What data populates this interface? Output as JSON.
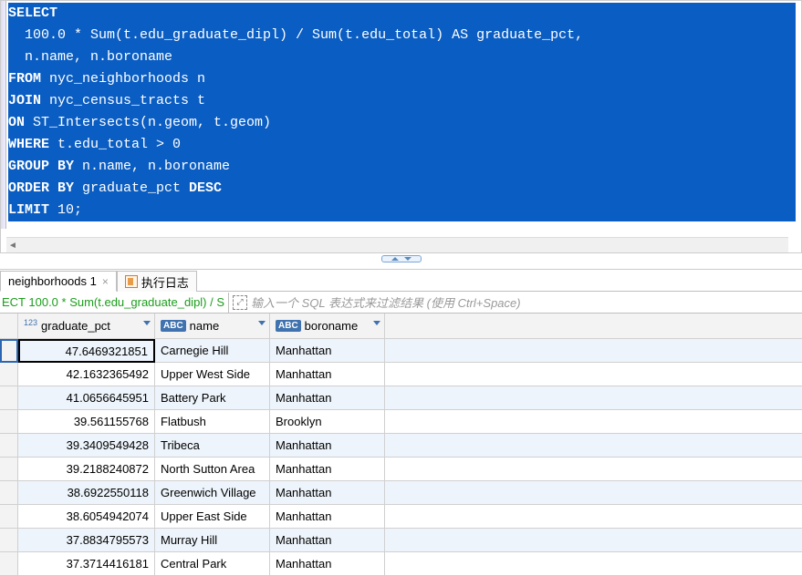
{
  "sql": {
    "line1_kw": "SELECT",
    "line2": "  100.0 * Sum(t.edu_graduate_dipl) / Sum(t.edu_total) AS graduate_pct,",
    "line3": "  n.name, n.boroname",
    "line4_kw": "FROM",
    "line4_rest": " nyc_neighborhoods n",
    "line5_kw": "JOIN",
    "line5_rest": " nyc_census_tracts t",
    "line6_kw": "ON",
    "line6_rest": " ST_Intersects(n.geom, t.geom)",
    "line7_kw": "WHERE",
    "line7_rest": " t.edu_total > 0",
    "line8_kw": "GROUP BY",
    "line8_rest": " n.name, n.boroname",
    "line9_kw": "ORDER BY",
    "line9_mid": " graduate_pct ",
    "line9_kw2": "DESC",
    "line10_kw": "LIMIT",
    "line10_rest": " 10;"
  },
  "tabs": {
    "result_tab": "neighborhoods 1",
    "log_tab": "执行日志"
  },
  "filter": {
    "summary": "ECT 100.0 * Sum(t.edu_graduate_dipl) / S",
    "placeholder": "输入一个 SQL 表达式来过滤结果 (使用 Ctrl+Space)"
  },
  "columns": {
    "c1": "graduate_pct",
    "c2": "name",
    "c3": "boroname"
  },
  "rows": [
    {
      "pct": "47.6469321851",
      "name": "Carnegie Hill",
      "boro": "Manhattan"
    },
    {
      "pct": "42.1632365492",
      "name": "Upper West Side",
      "boro": "Manhattan"
    },
    {
      "pct": "41.0656645951",
      "name": "Battery Park",
      "boro": "Manhattan"
    },
    {
      "pct": "39.561155768",
      "name": "Flatbush",
      "boro": "Brooklyn"
    },
    {
      "pct": "39.3409549428",
      "name": "Tribeca",
      "boro": "Manhattan"
    },
    {
      "pct": "39.2188240872",
      "name": "North Sutton Area",
      "boro": "Manhattan"
    },
    {
      "pct": "38.6922550118",
      "name": "Greenwich Village",
      "boro": "Manhattan"
    },
    {
      "pct": "38.6054942074",
      "name": "Upper East Side",
      "boro": "Manhattan"
    },
    {
      "pct": "37.8834795573",
      "name": "Murray Hill",
      "boro": "Manhattan"
    },
    {
      "pct": "37.3714416181",
      "name": "Central Park",
      "boro": "Manhattan"
    }
  ],
  "type_labels": {
    "num_sup": "123",
    "str": "ABC"
  }
}
